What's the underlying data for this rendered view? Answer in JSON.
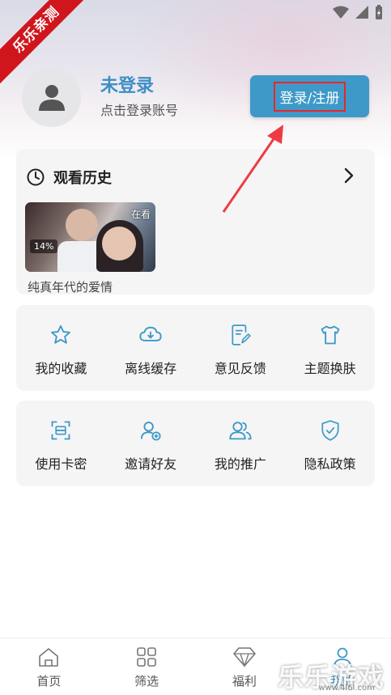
{
  "watermark": {
    "ribbon": "乐乐亲测",
    "corner": "乐乐游戏",
    "url": "www.4l6l.com"
  },
  "profile": {
    "title": "未登录",
    "subtitle": "点击登录账号",
    "login_button": "登录/注册"
  },
  "history": {
    "title": "观看历史",
    "items": [
      {
        "name": "纯真年代的爱情",
        "badge": "在看",
        "progress_label": "14%"
      }
    ]
  },
  "grid1": [
    {
      "label": "我的收藏",
      "icon": "star-icon"
    },
    {
      "label": "离线缓存",
      "icon": "cloud-download-icon"
    },
    {
      "label": "意见反馈",
      "icon": "feedback-edit-icon"
    },
    {
      "label": "主题换肤",
      "icon": "shirt-icon"
    }
  ],
  "grid2": [
    {
      "label": "使用卡密",
      "icon": "scan-icon"
    },
    {
      "label": "邀请好友",
      "icon": "add-user-icon"
    },
    {
      "label": "我的推广",
      "icon": "users-icon"
    },
    {
      "label": "隐私政策",
      "icon": "shield-check-icon"
    }
  ],
  "tabs": [
    {
      "label": "首页",
      "icon": "home-icon"
    },
    {
      "label": "筛选",
      "icon": "grid-icon"
    },
    {
      "label": "福利",
      "icon": "diamond-icon"
    },
    {
      "label": "我的",
      "icon": "user-icon"
    }
  ],
  "colors": {
    "accent": "#3e99c8",
    "title_blue": "#3d8fc5",
    "highlight_red": "#e8262a",
    "ribbon_red": "#d0151c",
    "icon_blue": "#3e99c8"
  }
}
